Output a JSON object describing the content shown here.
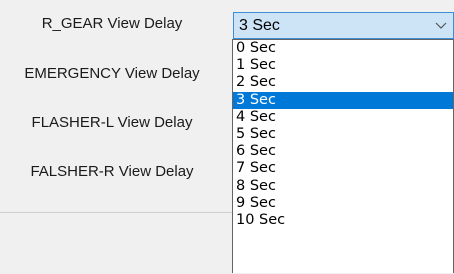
{
  "labels": [
    "R_GEAR View Delay",
    "EMERGENCY View Delay",
    "FLASHER-L View Delay",
    "FALSHER-R View Delay"
  ],
  "combo": {
    "value": "3 Sec",
    "options": [
      "0 Sec",
      "1 Sec",
      "2 Sec",
      "3 Sec",
      "4 Sec",
      "5 Sec",
      "6 Sec",
      "7 Sec",
      "8 Sec",
      "9 Sec",
      "10 Sec"
    ],
    "selected_index": 3
  },
  "colors": {
    "selection": "#0078d7",
    "combo_focus_bg": "#cde4f7",
    "combo_focus_border": "#3c8ed6"
  },
  "icons": {
    "combo_arrow": "chevron-down-icon"
  }
}
